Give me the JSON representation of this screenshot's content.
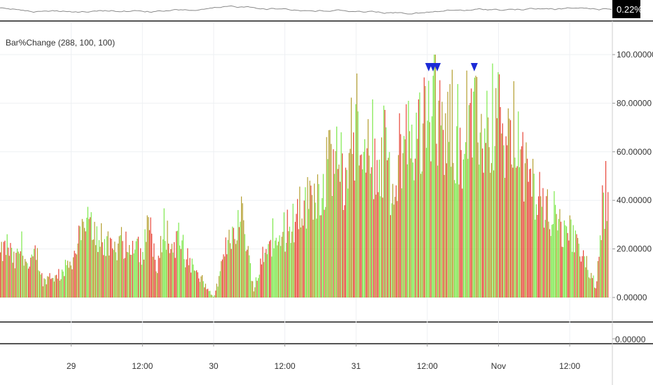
{
  "indicator": {
    "title": "Bar%Change (288, 100, 100)"
  },
  "top_pane": {
    "price_badge": "0.22%",
    "badge_color": "#000000"
  },
  "bottom_pane": {
    "label": "0.00000"
  },
  "colors": {
    "up": "#7CE84A",
    "down": "#E8473A",
    "mixed": "#B5A032",
    "marker": "#1C2BD6",
    "grid": "#EEF0F3",
    "separator": "#555555"
  },
  "chart_data": {
    "type": "bar",
    "title": "Bar%Change (288, 100, 100)",
    "ylim": [
      0,
      100
    ],
    "yticks": [
      "0.00000",
      "20.00000",
      "40.00000",
      "60.00000",
      "80.00000",
      "100.00000"
    ],
    "ytick_values": [
      0,
      20,
      40,
      60,
      80,
      100
    ],
    "x_tick_labels": [
      "29",
      "12:00",
      "30",
      "12:00",
      "31",
      "12:00",
      "Nov",
      "12:00"
    ],
    "x_tick_positions": [
      0.5,
      1.0,
      1.5,
      2.0,
      2.5,
      3.0,
      3.5,
      4.0
    ],
    "xlim": [
      0.0,
      4.27
    ],
    "envelope": [
      [
        0.0,
        22
      ],
      [
        0.05,
        28
      ],
      [
        0.1,
        18
      ],
      [
        0.15,
        28
      ],
      [
        0.2,
        14
      ],
      [
        0.25,
        25
      ],
      [
        0.3,
        8
      ],
      [
        0.35,
        12
      ],
      [
        0.4,
        10
      ],
      [
        0.45,
        15
      ],
      [
        0.5,
        20
      ],
      [
        0.55,
        28
      ],
      [
        0.6,
        40
      ],
      [
        0.65,
        36
      ],
      [
        0.7,
        30
      ],
      [
        0.75,
        28
      ],
      [
        0.8,
        22
      ],
      [
        0.85,
        32
      ],
      [
        0.9,
        20
      ],
      [
        0.95,
        35
      ],
      [
        1.0,
        18
      ],
      [
        1.05,
        42
      ],
      [
        1.1,
        12
      ],
      [
        1.15,
        40
      ],
      [
        1.2,
        25
      ],
      [
        1.25,
        32
      ],
      [
        1.3,
        20
      ],
      [
        1.35,
        15
      ],
      [
        1.4,
        10
      ],
      [
        1.45,
        5
      ],
      [
        1.5,
        0
      ],
      [
        1.55,
        15
      ],
      [
        1.6,
        32
      ],
      [
        1.65,
        38
      ],
      [
        1.7,
        44
      ],
      [
        1.75,
        20
      ],
      [
        1.78,
        2
      ],
      [
        1.8,
        12
      ],
      [
        1.85,
        22
      ],
      [
        1.9,
        30
      ],
      [
        1.95,
        28
      ],
      [
        2.0,
        34
      ],
      [
        2.05,
        40
      ],
      [
        2.1,
        42
      ],
      [
        2.15,
        50
      ],
      [
        2.2,
        58
      ],
      [
        2.25,
        56
      ],
      [
        2.3,
        68
      ],
      [
        2.35,
        76
      ],
      [
        2.4,
        60
      ],
      [
        2.45,
        72
      ],
      [
        2.5,
        88
      ],
      [
        2.55,
        62
      ],
      [
        2.58,
        80
      ],
      [
        2.62,
        72
      ],
      [
        2.66,
        68
      ],
      [
        2.7,
        76
      ],
      [
        2.75,
        45
      ],
      [
        2.8,
        70
      ],
      [
        2.85,
        88
      ],
      [
        2.9,
        82
      ],
      [
        2.95,
        84
      ],
      [
        3.0,
        92
      ],
      [
        3.05,
        96
      ],
      [
        3.1,
        90
      ],
      [
        3.15,
        88
      ],
      [
        3.2,
        84
      ],
      [
        3.25,
        80
      ],
      [
        3.3,
        90
      ],
      [
        3.35,
        92
      ],
      [
        3.4,
        86
      ],
      [
        3.45,
        88
      ],
      [
        3.5,
        85
      ],
      [
        3.55,
        80
      ],
      [
        3.6,
        84
      ],
      [
        3.65,
        70
      ],
      [
        3.7,
        66
      ],
      [
        3.75,
        58
      ],
      [
        3.8,
        52
      ],
      [
        3.85,
        44
      ],
      [
        3.9,
        38
      ],
      [
        3.95,
        34
      ],
      [
        4.0,
        32
      ],
      [
        4.05,
        28
      ],
      [
        4.1,
        20
      ],
      [
        4.15,
        12
      ],
      [
        4.18,
        4
      ],
      [
        4.2,
        25
      ],
      [
        4.23,
        48
      ],
      [
        4.26,
        56
      ]
    ],
    "markers": [
      3.01,
      3.04,
      3.07,
      3.33
    ]
  }
}
